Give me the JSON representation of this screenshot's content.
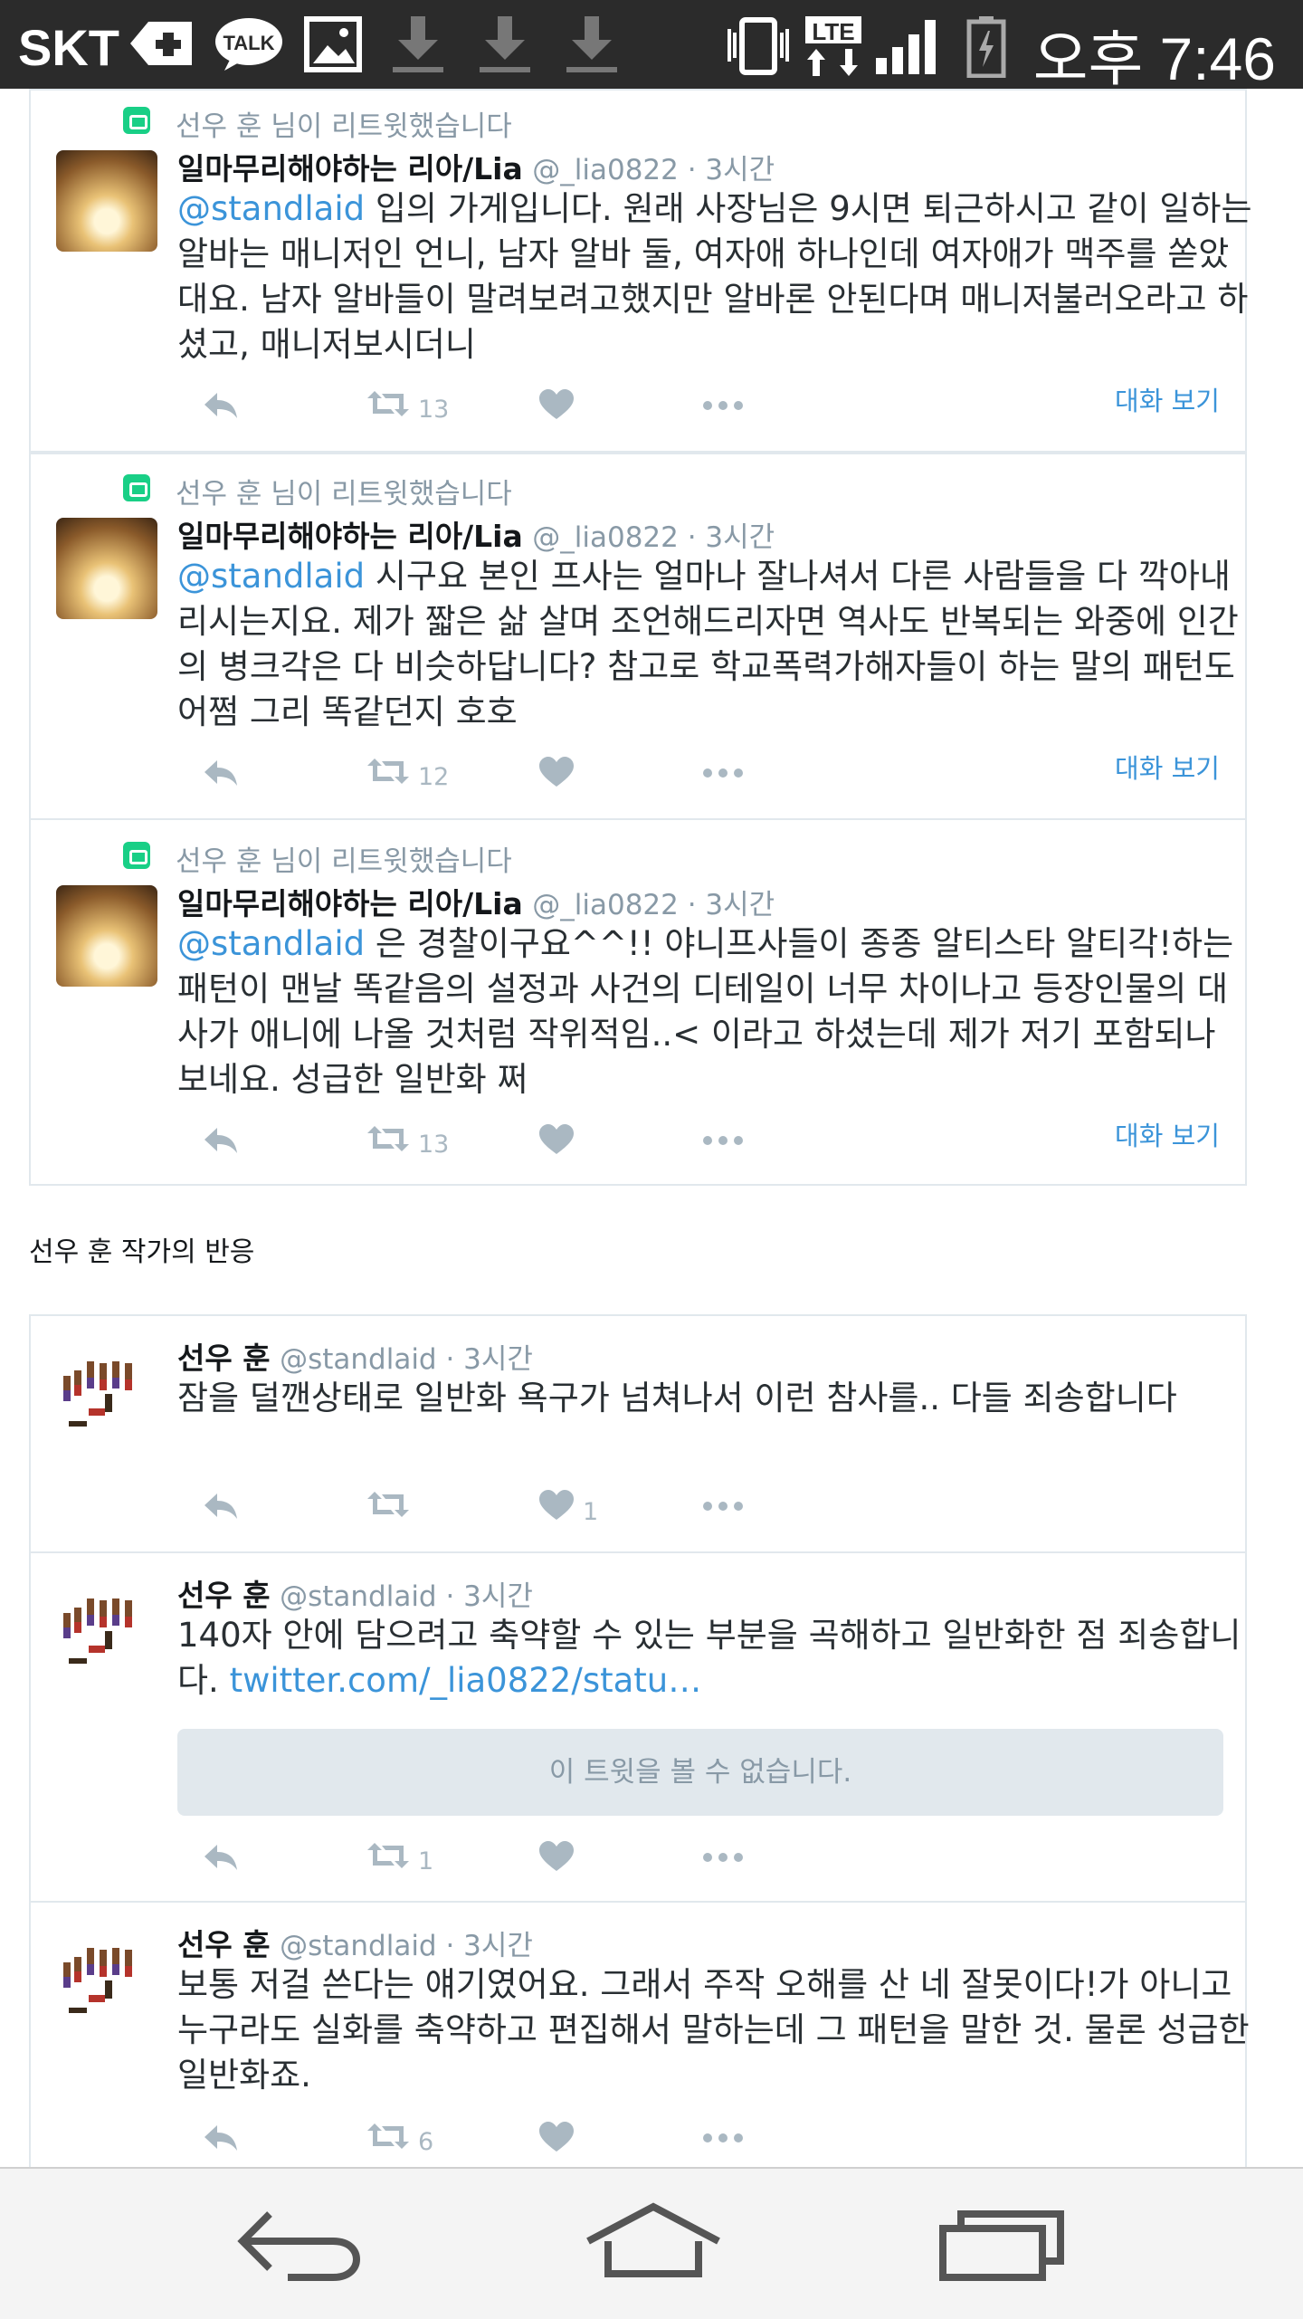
{
  "status_bar": {
    "carrier": "SKT",
    "talk_label": "TALK",
    "lte_label": "LTE",
    "time": "오후 7:46"
  },
  "tweets": [
    {
      "retweet_by": "선우 훈 님이 리트윗했습니다",
      "name": "일마무리해야하는 리아/Lia",
      "handle": "@_lia0822 · 3시간",
      "mention": "@standlaid",
      "text": " 입의 가게입니다. 원래 사장님은 9시면 퇴근하시고 같이 일하는 알바는 매니저인 언니, 남자 알바 둘, 여자애 하나인데 여자애가 맥주를 쏟았대요. 남자 알바들이 말려보려고했지만 알바론 안된다며 매니저불러오라고 하셨고, 매니저보시더니",
      "retweets": "13",
      "convo": "대화 보기"
    },
    {
      "retweet_by": "선우 훈 님이 리트윗했습니다",
      "name": "일마무리해야하는 리아/Lia",
      "handle": "@_lia0822 · 3시간",
      "mention": "@standlaid",
      "text": " 시구요 본인 프사는 얼마나 잘나셔서 다른 사람들을 다 깍아내리시는지요. 제가 짧은 삶 살며 조언해드리자면 역사도 반복되는 와중에 인간의 병크각은 다 비슷하답니다? 참고로 학교폭력가해자들이 하는 말의 패턴도 어쩜 그리 똑같던지 호호",
      "retweets": "12",
      "convo": "대화 보기"
    },
    {
      "retweet_by": "선우 훈 님이 리트윗했습니다",
      "name": "일마무리해야하는 리아/Lia",
      "handle": "@_lia0822 · 3시간",
      "mention": "@standlaid",
      "text": " 은 경찰이구요^^!! 야니프사들이 종종 알티스타 알티각!하는 패턴이 맨날 똑같음의 설정과 사건의 디테일이 너무 차이나고 등장인물의 대사가 애니에 나올 것처럼 작위적임..< 이라고 하셨는데 제가 저기 포함되나 보네요. 성급한 일반화 쩌",
      "retweets": "13",
      "convo": "대화 보기"
    }
  ],
  "section_label": "선우 훈 작가의 반응",
  "replies": [
    {
      "name": "선우 훈",
      "handle": "@standlaid · 3시간",
      "text": "잠을 덜깬상태로 일반화 욕구가 넘쳐나서 이런 참사를.. 다들 죄송합니다",
      "likes": "1"
    },
    {
      "name": "선우 훈",
      "handle": "@standlaid · 3시간",
      "text": "140자 안에 담으려고 축약할 수 있는 부분을 곡해하고 일반화한 점 죄송합니다. ",
      "link": "twitter.com/_lia0822/statu…",
      "unavailable": "이 트윗을 볼 수 없습니다.",
      "retweets": "1"
    },
    {
      "name": "선우 훈",
      "handle": "@standlaid · 3시간",
      "text": "보통 저걸 쓴다는 얘기였어요. 그래서 주작 오해를 산 네 잘못이다!가 아니고 누구라도 실화를 축약하고 편집해서 말하는데 그 패턴을 말한 것. 물론 성급한 일반화죠.",
      "retweets": "6"
    }
  ]
}
